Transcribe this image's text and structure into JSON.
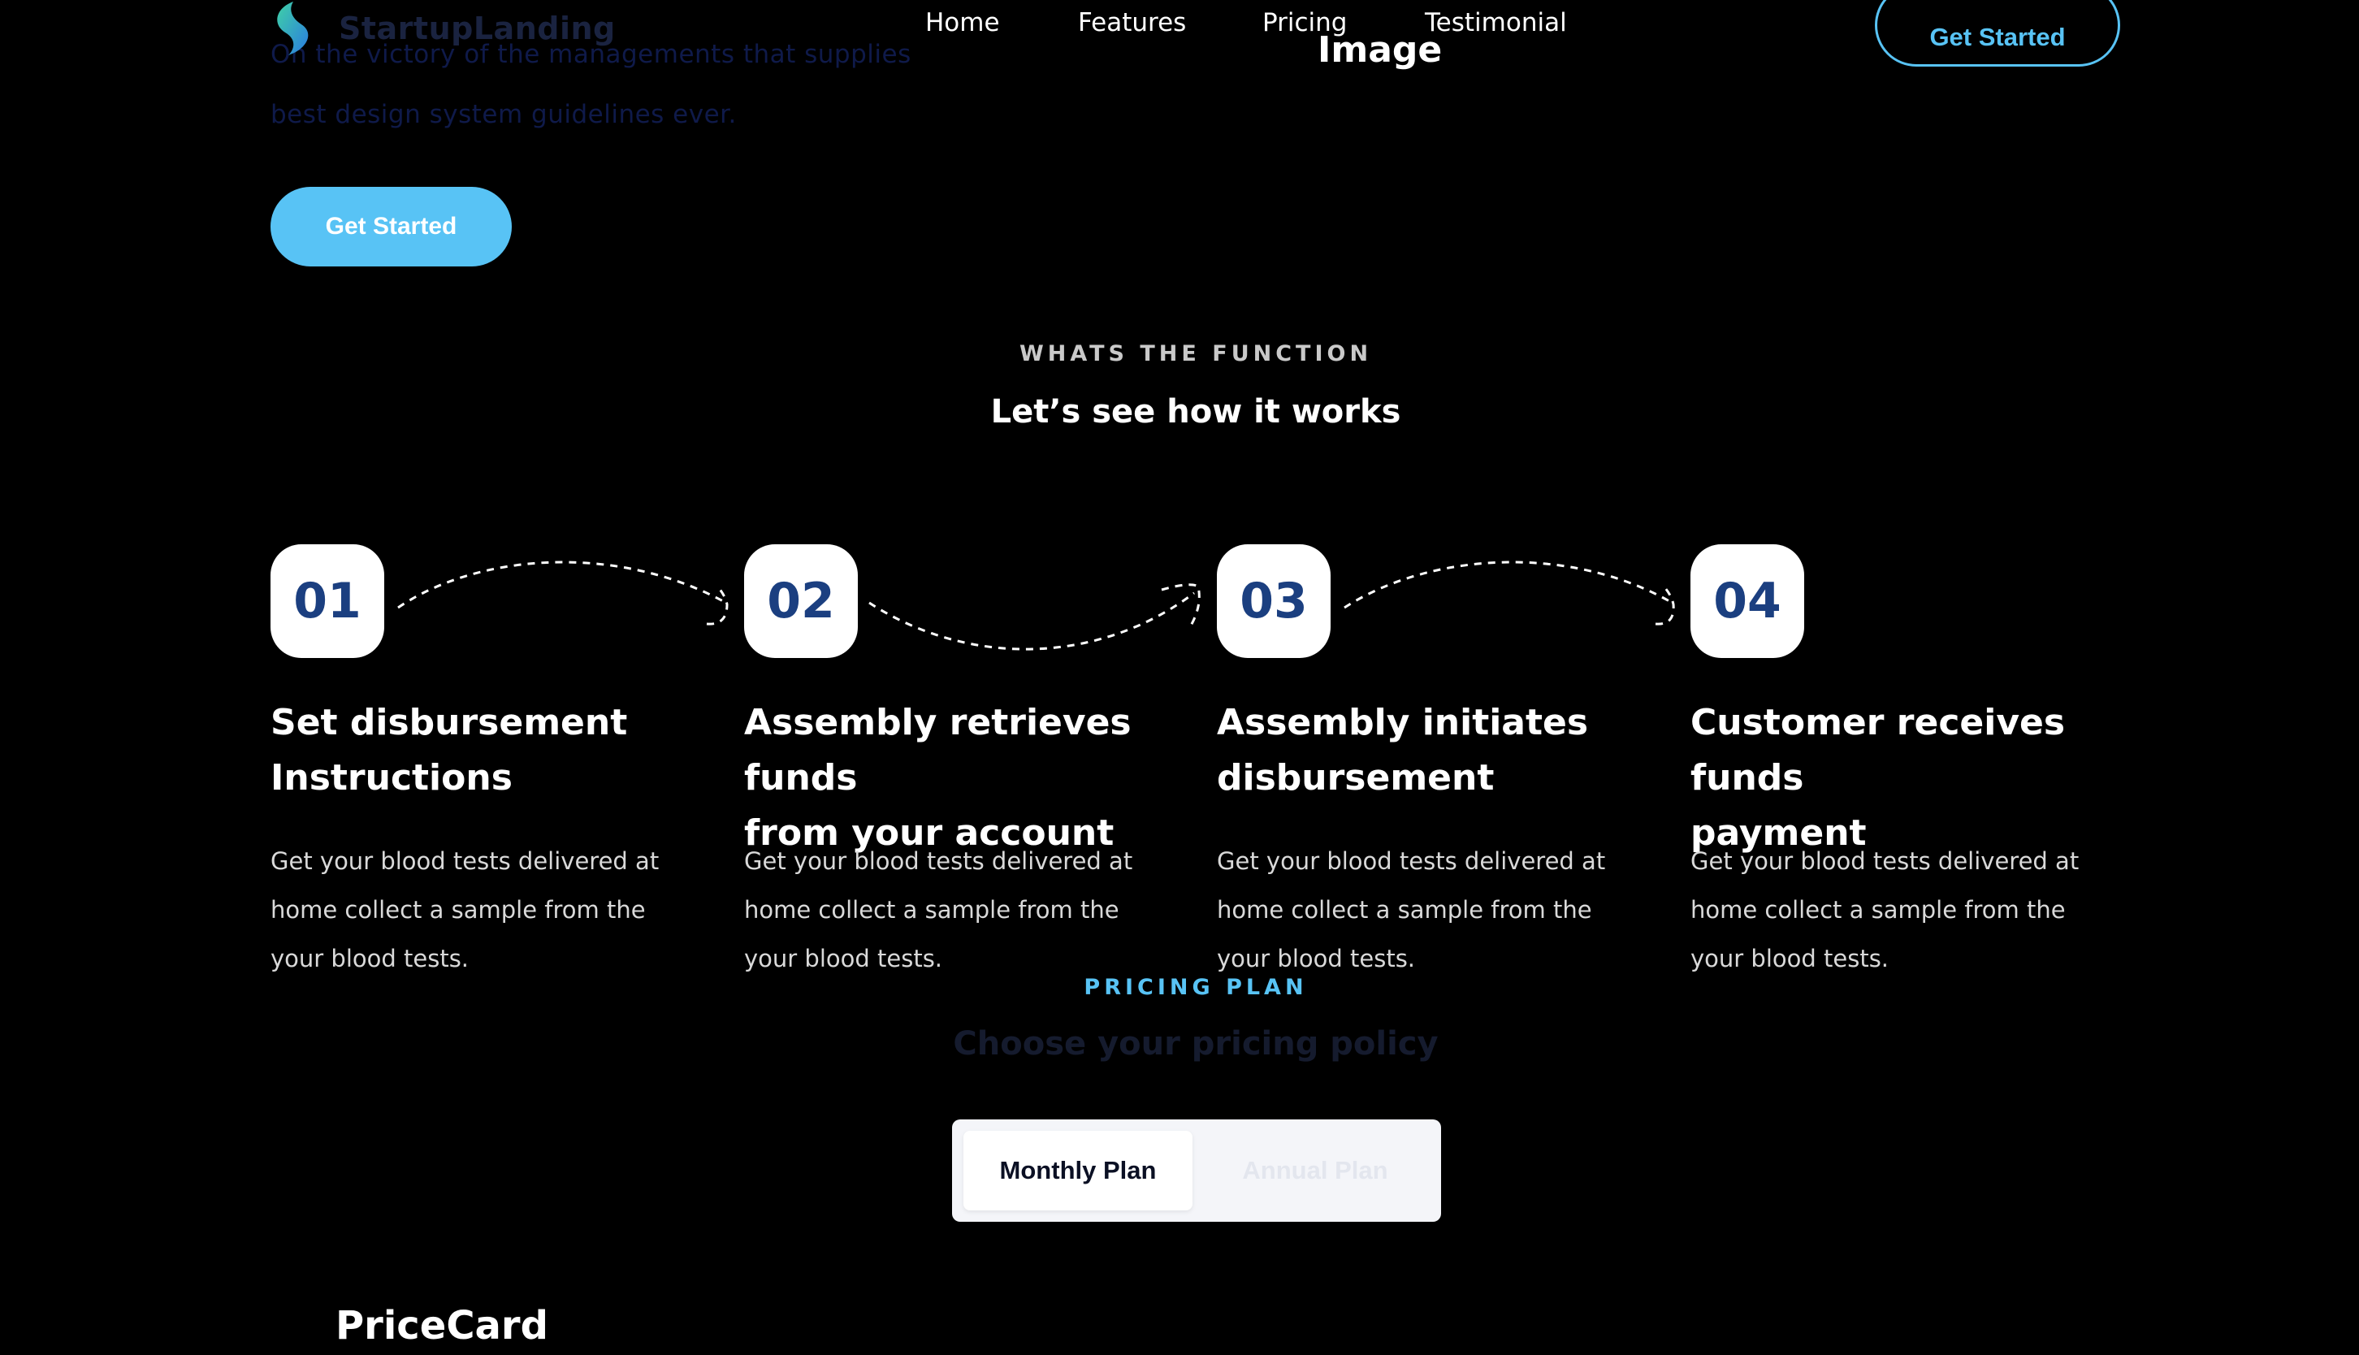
{
  "hero": {
    "line1": "On the victory of the managements that supplies",
    "line2": "best design system guidelines ever.",
    "cta": "Get Started"
  },
  "nav": {
    "brand": "StartupLanding",
    "links": [
      "Home",
      "Features",
      "Pricing",
      "Testimonial"
    ],
    "image_label": "Image",
    "cta": "Get Started"
  },
  "how_it_works": {
    "eyebrow": "WHATS THE FUNCTION",
    "title": "Let’s see how it works",
    "steps": [
      {
        "number": "01",
        "title_line1": "Set disbursement",
        "title_line2": "Instructions",
        "desc_line1": "Get your blood tests delivered at",
        "desc_line2": "home collect a sample from the",
        "desc_line3": "your blood tests."
      },
      {
        "number": "02",
        "title_line1": "Assembly retrieves funds",
        "title_line2": "from your account",
        "desc_line1": "Get your blood tests delivered at",
        "desc_line2": "home collect a sample from the",
        "desc_line3": "your blood tests."
      },
      {
        "number": "03",
        "title_line1": "Assembly initiates",
        "title_line2": "disbursement",
        "desc_line1": "Get your blood tests delivered at",
        "desc_line2": "home collect a sample from the",
        "desc_line3": "your blood tests."
      },
      {
        "number": "04",
        "title_line1": "Customer receives funds",
        "title_line2": "payment",
        "desc_line1": "Get your blood tests delivered at",
        "desc_line2": "home collect a sample from the",
        "desc_line3": "your blood tests."
      }
    ]
  },
  "pricing": {
    "eyebrow": "PRICING PLAN",
    "title": "Choose your pricing policy",
    "toggle": {
      "monthly": "Monthly Plan",
      "annual": "Annual Plan",
      "selected": "Monthly Plan"
    },
    "card_label": "PriceCard"
  },
  "colors": {
    "background": "#000000",
    "accent": "#58c3f5",
    "badge_text": "#1b3f80"
  }
}
